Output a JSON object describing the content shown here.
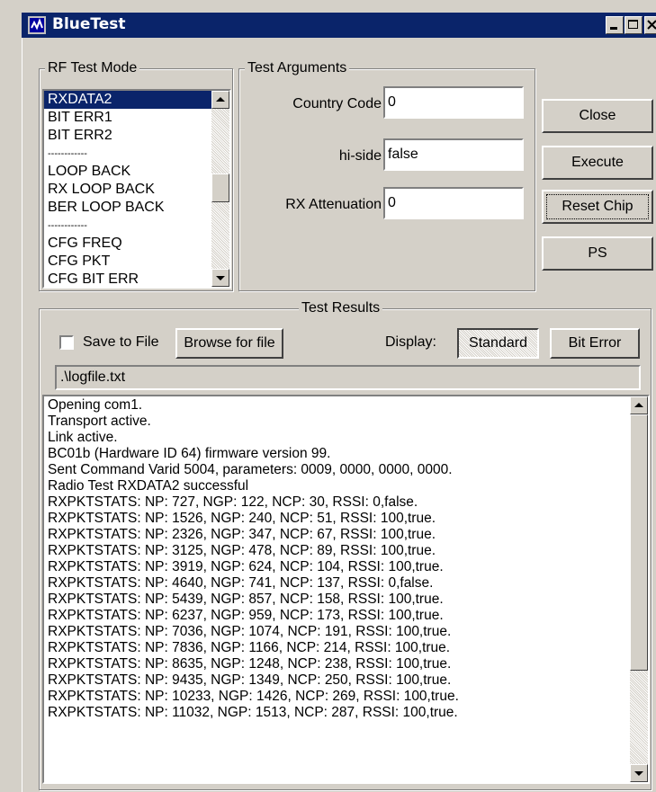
{
  "window": {
    "title": "BlueTest"
  },
  "rf_test_mode": {
    "group_label": "RF Test Mode",
    "items": [
      {
        "label": "RXDATA2",
        "selected": true
      },
      {
        "label": "BIT ERR1"
      },
      {
        "label": "BIT ERR2"
      },
      {
        "label": "------------"
      },
      {
        "label": "LOOP BACK"
      },
      {
        "label": "RX LOOP BACK"
      },
      {
        "label": "BER LOOP BACK"
      },
      {
        "label": "------------"
      },
      {
        "label": "CFG FREQ"
      },
      {
        "label": "CFG PKT"
      },
      {
        "label": "CFG BIT ERR"
      }
    ]
  },
  "test_arguments": {
    "group_label": "Test Arguments",
    "country_code": {
      "label": "Country Code",
      "value": "0"
    },
    "hi_side": {
      "label": "hi-side",
      "value": "false"
    },
    "rx_attenuation": {
      "label": "RX Attenuation",
      "value": "0"
    }
  },
  "buttons": {
    "close": "Close",
    "execute": "Execute",
    "reset_chip": "Reset Chip",
    "ps": "PS"
  },
  "test_results": {
    "group_label": "Test Results",
    "save_to_file_label": "Save to File",
    "save_to_file_checked": false,
    "browse_label": "Browse for file",
    "display_label": "Display:",
    "standard_label": "Standard",
    "bit_error_label": "Bit Error",
    "file_path": ".\\logfile.txt",
    "log_lines": [
      "Opening com1.",
      "Transport active.",
      "Link active.",
      "BC01b (Hardware ID 64) firmware version 99.",
      "Sent Command Varid 5004, parameters: 0009, 0000, 0000, 0000.",
      "Radio Test RXDATA2 successful",
      "RXPKTSTATS: NP: 727, NGP: 122, NCP: 30, RSSI: 0,false.",
      "RXPKTSTATS: NP: 1526, NGP: 240, NCP: 51, RSSI: 100,true.",
      "RXPKTSTATS: NP: 2326, NGP: 347, NCP: 67, RSSI: 100,true.",
      "RXPKTSTATS: NP: 3125, NGP: 478, NCP: 89, RSSI: 100,true.",
      "RXPKTSTATS: NP: 3919, NGP: 624, NCP: 104, RSSI: 100,true.",
      "RXPKTSTATS: NP: 4640, NGP: 741, NCP: 137, RSSI: 0,false.",
      "RXPKTSTATS: NP: 5439, NGP: 857, NCP: 158, RSSI: 100,true.",
      "RXPKTSTATS: NP: 6237, NGP: 959, NCP: 173, RSSI: 100,true.",
      "RXPKTSTATS: NP: 7036, NGP: 1074, NCP: 191, RSSI: 100,true.",
      "RXPKTSTATS: NP: 7836, NGP: 1166, NCP: 214, RSSI: 100,true.",
      "RXPKTSTATS: NP: 8635, NGP: 1248, NCP: 238, RSSI: 100,true.",
      "RXPKTSTATS: NP: 9435, NGP: 1349, NCP: 250, RSSI: 100,true.",
      "RXPKTSTATS: NP: 10233, NGP: 1426, NCP: 269, RSSI: 100,true.",
      "RXPKTSTATS: NP: 11032, NGP: 1513, NCP: 287, RSSI: 100,true."
    ]
  },
  "icons": {
    "app": "bluetest-app-icon",
    "minimize": "minimize-icon",
    "maximize": "maximize-icon",
    "close": "close-icon"
  }
}
